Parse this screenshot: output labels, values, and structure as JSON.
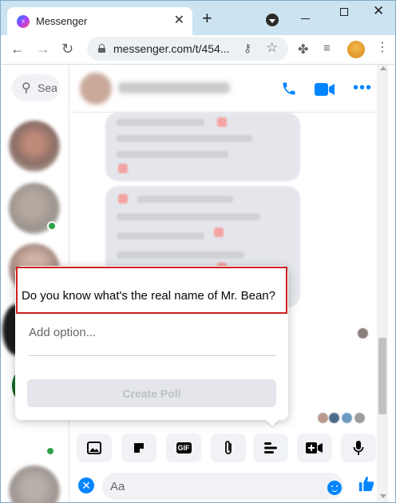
{
  "browser": {
    "tab_title": "Messenger",
    "tab_close": "✕",
    "new_tab": "+",
    "url": "messenger.com/t/454..."
  },
  "sidebar": {
    "search_placeholder": "Search"
  },
  "chat": {
    "phone_label": "",
    "more_label": "•••"
  },
  "poll": {
    "question": "Do you know what's the real name of Mr. Bean?",
    "add_option": "Add option...",
    "create_button": "Create Poll"
  },
  "composer": {
    "placeholder": "Aa",
    "gif_label": "GIF",
    "close_label": "✕"
  },
  "colors": {
    "accent": "#0084ff",
    "highlight": "#cc1f1f"
  }
}
